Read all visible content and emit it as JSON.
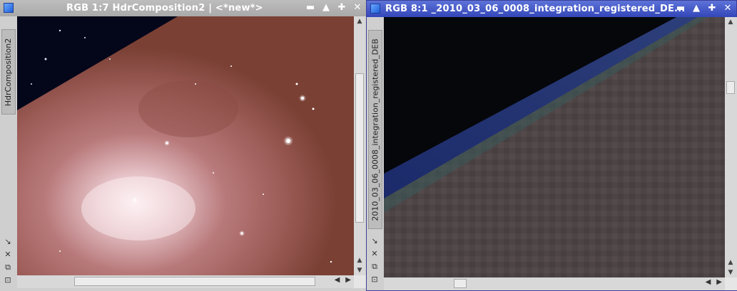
{
  "window1": {
    "title": "RGB 1:7 HdrComposition2 | <*new*>",
    "side_tab": "HdrComposition2",
    "buttons": [
      "▬",
      "▲",
      "✚",
      "✕"
    ]
  },
  "window2": {
    "title": "RGB 8:1 _2010_03_06_0008_integration_registered_DE...",
    "side_tab": "2010_03_06_0008_integration_registered_DEB",
    "buttons": [
      "▬",
      "▲",
      "✚",
      "✕"
    ]
  },
  "scroll_arrows": {
    "up": "▲",
    "down": "▼",
    "left": "◀",
    "right": "▶"
  },
  "tools": [
    "↘",
    "✕",
    "⧉",
    "⊡"
  ],
  "colors": {
    "active_titlebar": "#3446b9",
    "inactive_titlebar": "#a9a9a9",
    "nebula": "#a0625f",
    "sky": "#05081a"
  }
}
